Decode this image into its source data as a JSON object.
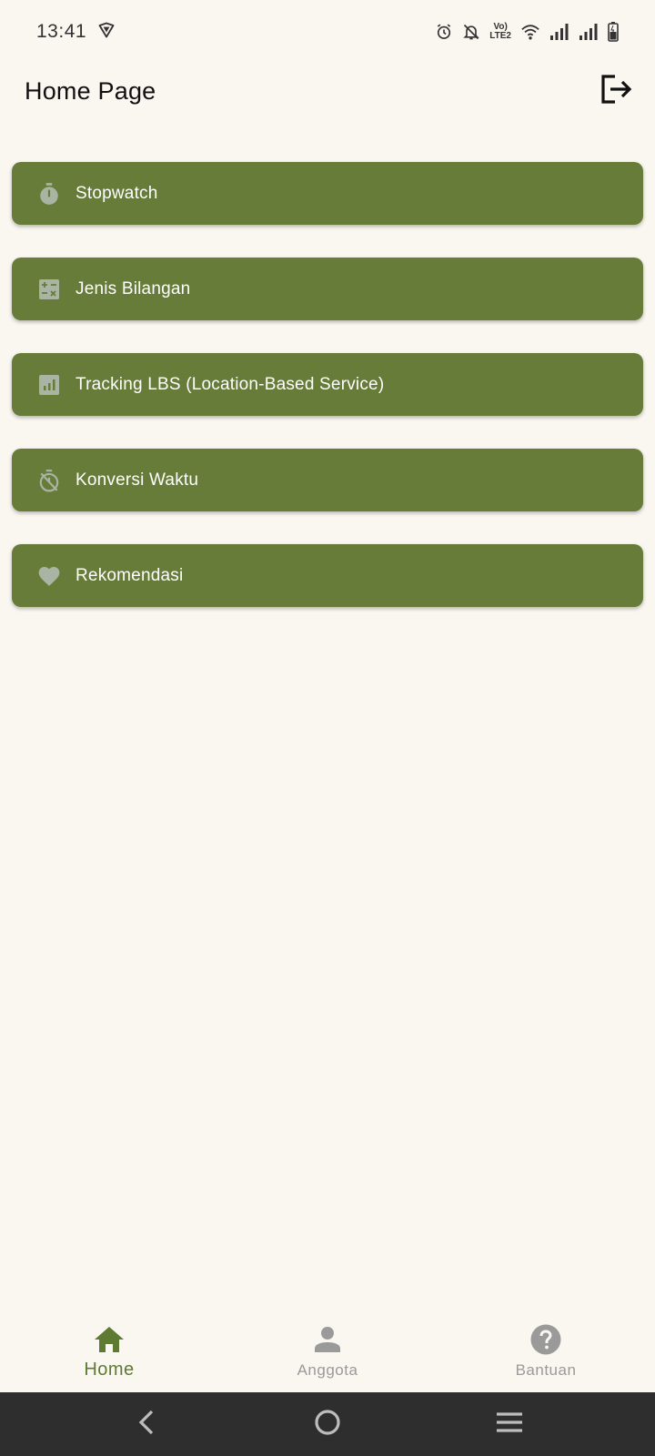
{
  "status_bar": {
    "time": "13:41",
    "volte_top": "Vo)",
    "volte_bottom": "LTE2",
    "icons": [
      "vpn-shield-icon",
      "alarm-icon",
      "notifications-off-icon",
      "volte-icon",
      "wifi-icon",
      "signal-icon",
      "signal-icon",
      "battery-icon"
    ]
  },
  "app_bar": {
    "title": "Home Page",
    "logout_icon": "logout-icon"
  },
  "menu": {
    "items": [
      {
        "label": "Stopwatch",
        "icon": "timer-icon"
      },
      {
        "label": "Jenis Bilangan",
        "icon": "calculate-icon"
      },
      {
        "label": "Tracking LBS (Location-Based Service)",
        "icon": "analytics-icon"
      },
      {
        "label": "Konversi Waktu",
        "icon": "timer-off-icon"
      },
      {
        "label": "Rekomendasi",
        "icon": "favorite-icon"
      }
    ]
  },
  "bottom_nav": {
    "items": [
      {
        "label": "Home",
        "icon": "home-icon",
        "active": true
      },
      {
        "label": "Anggota",
        "icon": "person-icon",
        "active": false
      },
      {
        "label": "Bantuan",
        "icon": "help-icon",
        "active": false
      }
    ]
  },
  "system_nav": {
    "buttons": [
      "back-icon",
      "home-circle-icon",
      "menu-lines-icon"
    ]
  },
  "colors": {
    "background": "#FAF6F0",
    "menu_item": "#667C38",
    "menu_icon": "#A9B5A2",
    "active_nav": "#5F7A33",
    "inactive_nav": "#9A9A9A",
    "system_nav": "#2E2E2E"
  }
}
